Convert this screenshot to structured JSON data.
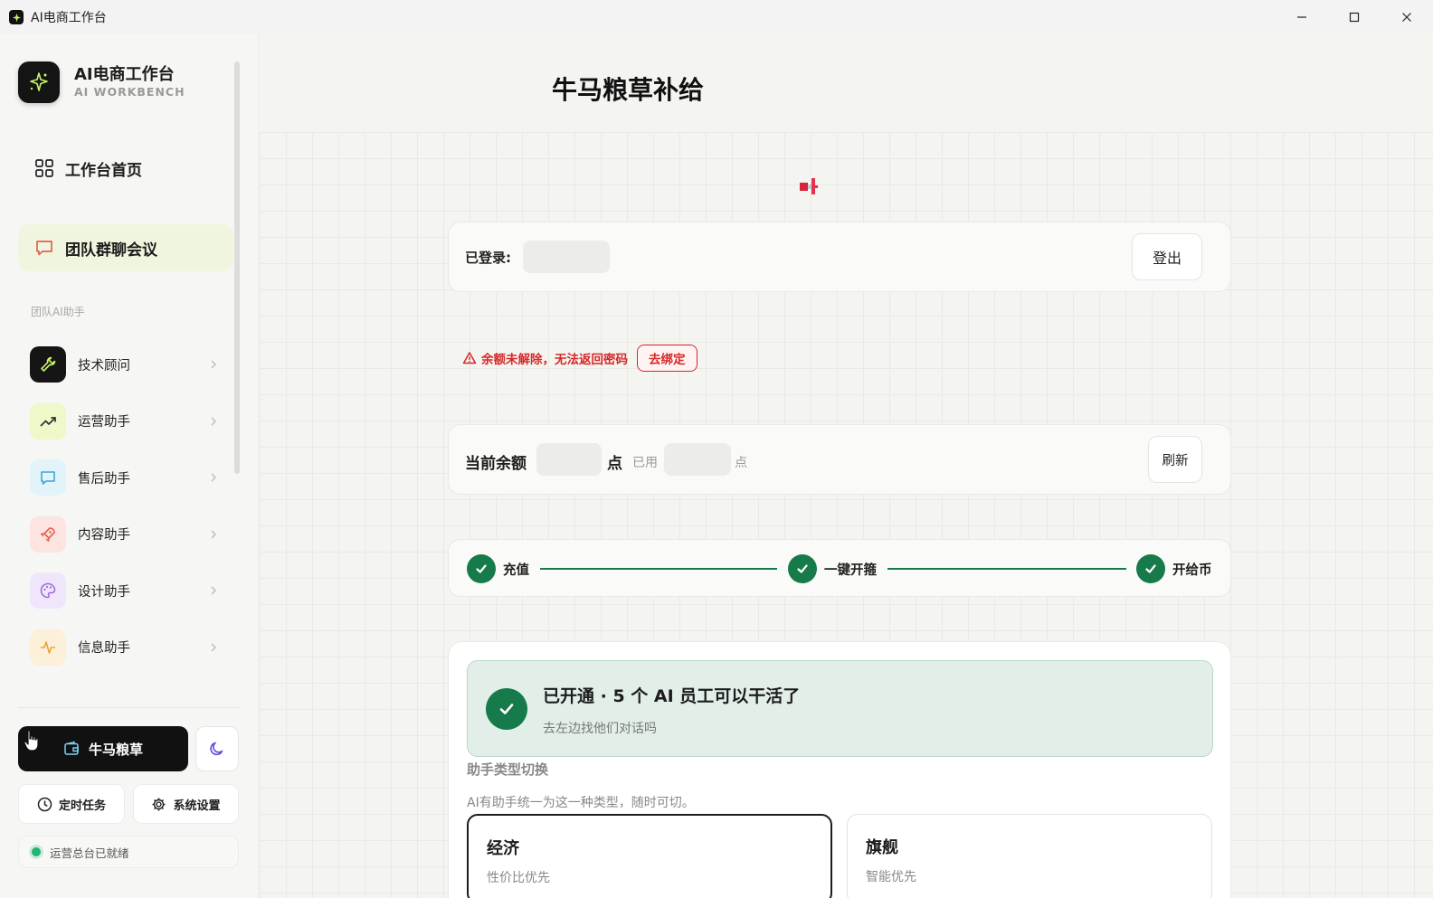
{
  "window": {
    "title": "AI电商工作台"
  },
  "brand": {
    "name": "AI电商工作台",
    "subtitle": "AI WORKBENCH"
  },
  "nav": {
    "home": "工作台首页",
    "team_chat": "团队群聊会议"
  },
  "section_label": "团队AI助手",
  "assistants": [
    {
      "label": "技术顾问",
      "icon": "wrench-icon",
      "bg": "#151515",
      "fg": "#c8f56a"
    },
    {
      "label": "运营助手",
      "icon": "trend-up-icon",
      "bg": "#eef8c8",
      "fg": "#333333"
    },
    {
      "label": "售后助手",
      "icon": "chat-icon",
      "bg": "#e2f4fa",
      "fg": "#3ba7d6"
    },
    {
      "label": "内容助手",
      "icon": "rocket-icon",
      "bg": "#fde4e0",
      "fg": "#e0624e"
    },
    {
      "label": "设计助手",
      "icon": "palette-icon",
      "bg": "#f0e6fb",
      "fg": "#9b6bd6"
    },
    {
      "label": "信息助手",
      "icon": "pulse-icon",
      "bg": "#fdf0d8",
      "fg": "#e8a53a"
    }
  ],
  "bottom": {
    "niuma_label": "牛马粮草",
    "timer_label": "定时任务",
    "settings_label": "系统设置",
    "status_text": "运营总台已就绪"
  },
  "main": {
    "title": "牛马粮草补给",
    "login": {
      "label": "已登录:",
      "logout": "登出"
    },
    "warning": {
      "text": "余额未解除，无法返回密码",
      "action": "去绑定"
    },
    "balance": {
      "label": "当前余额",
      "unit": "点",
      "used_label": "已用",
      "used_unit": "点",
      "refresh": "刷新"
    },
    "steps": [
      {
        "label": "充值",
        "done": true
      },
      {
        "label": "一键开箍",
        "done": true
      },
      {
        "label": "开给币",
        "done": true
      }
    ],
    "success": {
      "title": "已开通 · 5 个 AI 员工可以干活了",
      "subtitle": "去左边找他们对话吗"
    },
    "type_switch": {
      "title": "助手类型切换",
      "desc": "AI有助手统一为这一种类型，随时可切。",
      "options": [
        {
          "name": "经济",
          "desc": "性价比优先",
          "selected": true
        },
        {
          "name": "旗舰",
          "desc": "智能优先",
          "selected": false
        }
      ]
    }
  },
  "colors": {
    "accent_green": "#167a4a",
    "warning_red": "#d62828",
    "sidebar_active": "#f0f5df"
  }
}
